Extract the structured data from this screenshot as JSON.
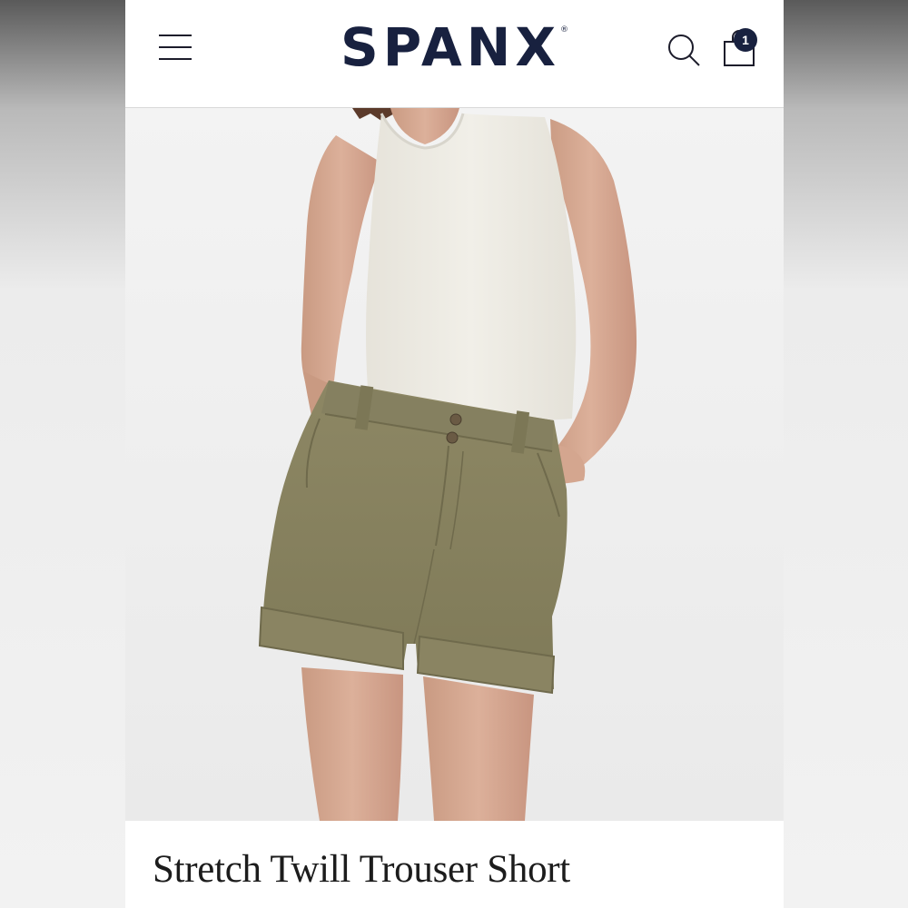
{
  "header": {
    "brand": "SPANX",
    "brand_mark": "®",
    "menu_icon": "hamburger-menu-icon",
    "search_icon": "search-icon",
    "bag_icon": "shopping-bag-icon",
    "cart_count": "1"
  },
  "product": {
    "image_description": "model wearing white tank top and olive stretch twill shorts",
    "title": "Stretch Twill Trouser Short"
  },
  "colors": {
    "brand_navy": "#18213f",
    "shorts_olive": "#8a8462",
    "tank_white": "#efede6"
  }
}
